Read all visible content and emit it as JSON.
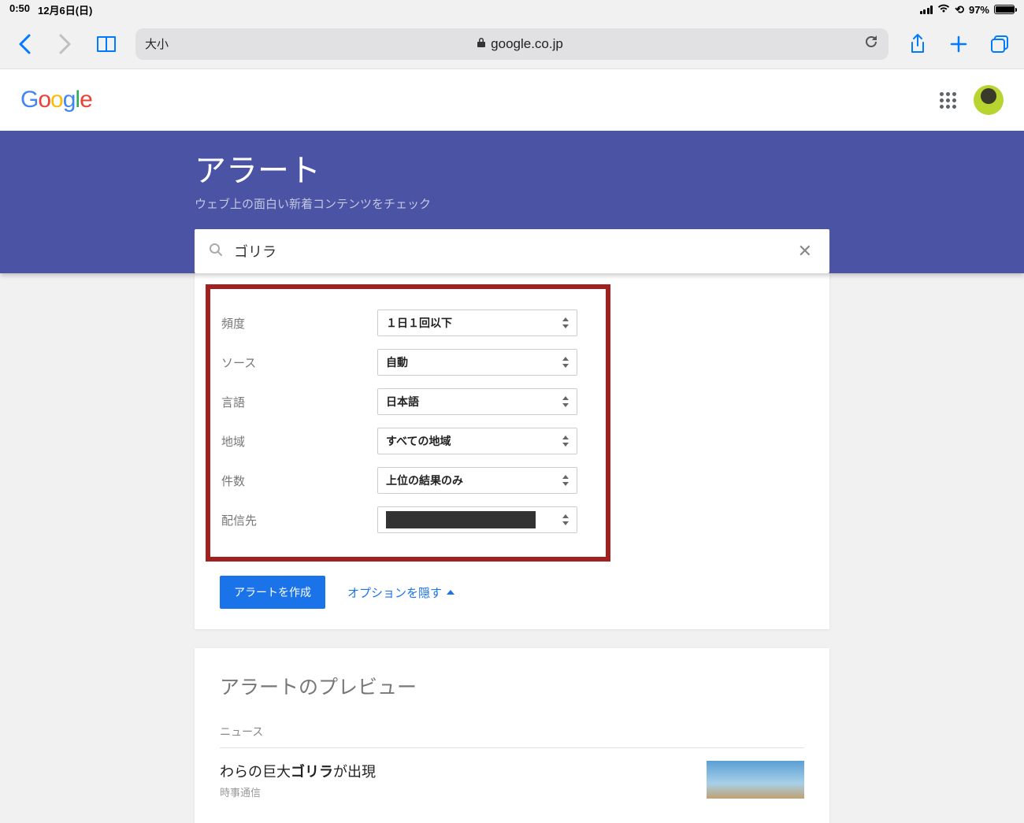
{
  "status": {
    "time": "0:50",
    "date": "12月6日(日)",
    "battery": "97%"
  },
  "safari": {
    "text_size": "大小",
    "domain": "google.co.jp"
  },
  "google_logo": {
    "c0": "G",
    "c1": "o",
    "c2": "o",
    "c3": "g",
    "c4": "l",
    "c5": "e"
  },
  "hero": {
    "title": "アラート",
    "subtitle": "ウェブ上の面白い新着コンテンツをチェック",
    "search_value": "ゴリラ"
  },
  "options": {
    "rows": [
      {
        "label": "頻度",
        "value": "１日１回以下"
      },
      {
        "label": "ソース",
        "value": "自動"
      },
      {
        "label": "言語",
        "value": "日本語"
      },
      {
        "label": "地域",
        "value": "すべての地域"
      },
      {
        "label": "件数",
        "value": "上位の結果のみ"
      },
      {
        "label": "配信先",
        "value": "██████████████"
      }
    ],
    "create_button": "アラートを作成",
    "hide_link": "オプションを隠す"
  },
  "preview": {
    "title": "アラートのプレビュー",
    "section": "ニュース",
    "item": {
      "headline_pre": "わらの巨大",
      "headline_bold": "ゴリラ",
      "headline_post": "が出現",
      "source": "時事通信"
    }
  }
}
